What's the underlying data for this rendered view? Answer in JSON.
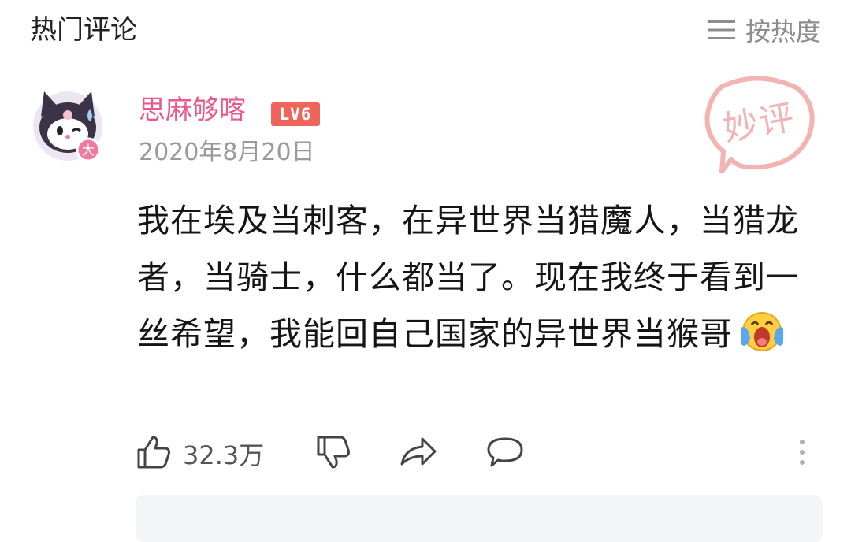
{
  "header": {
    "title": "热门评论",
    "sort_label": "按热度"
  },
  "comment": {
    "username": "思麻够喀",
    "level": "LV6",
    "date": "2020年8月20日",
    "stamp": "妙评",
    "text": "我在埃及当刺客，在异世界当猎魔人，当猎龙者，当骑士，什么都当了。现在我终于看到一丝希望，我能回自己国家的异世界当猴哥",
    "emoji": "crying-emoji",
    "likes": "32.3万"
  },
  "colors": {
    "username": "#e85a8c",
    "level_badge": "#f0645c",
    "stamp": "#f3b3b3",
    "muted": "#9a9a9a"
  },
  "icons": {
    "sort": "menu-lines-icon",
    "like": "thumbs-up-icon",
    "dislike": "thumbs-down-icon",
    "share": "share-arrow-icon",
    "comment": "speech-bubble-icon",
    "more": "more-vertical-icon"
  }
}
